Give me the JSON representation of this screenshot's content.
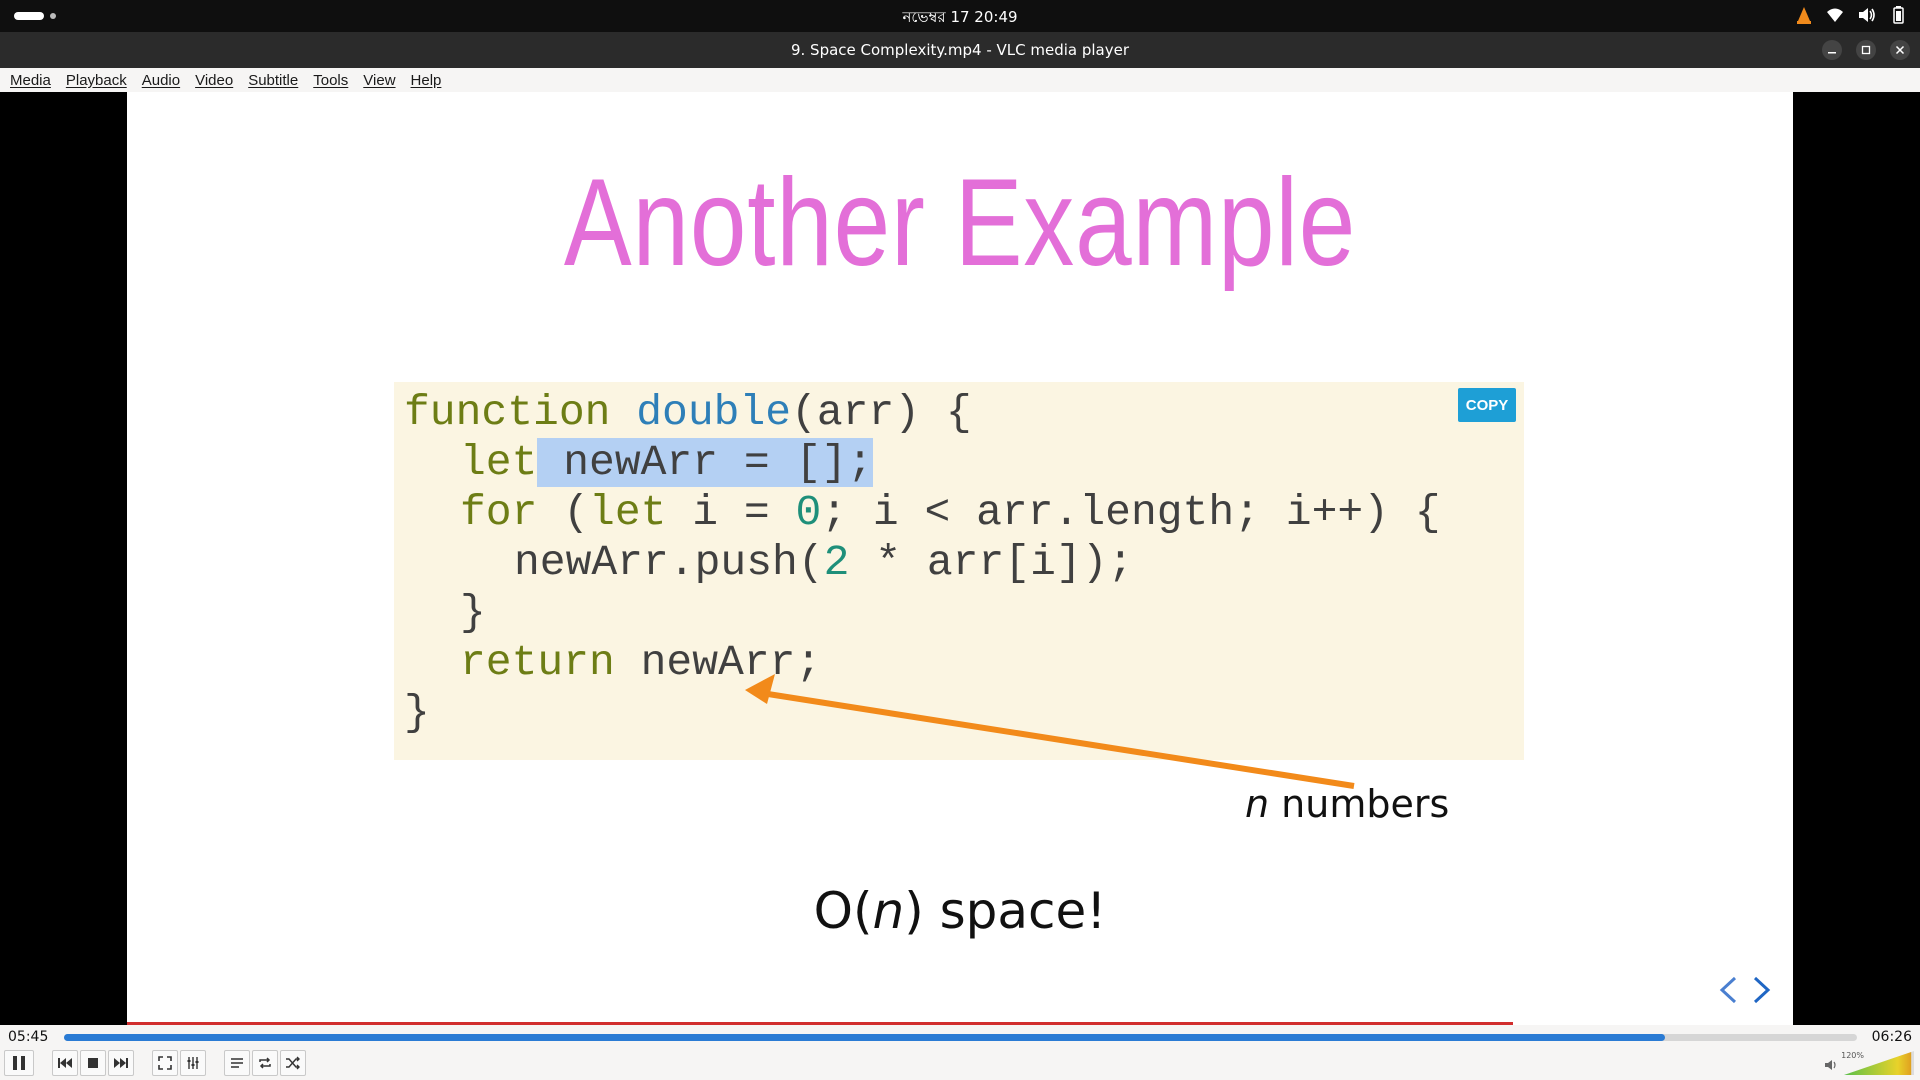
{
  "topbar": {
    "clock": "নভেম্বর 17  20:49"
  },
  "window": {
    "title": "9. Space Complexity.mp4 - VLC media player"
  },
  "menu": {
    "items": [
      "Media",
      "Playback",
      "Audio",
      "Video",
      "Subtitle",
      "Tools",
      "View",
      "Help"
    ]
  },
  "slide": {
    "title": "Another Example",
    "copy_label": "COPY",
    "code": {
      "l1_kw": "function",
      "l1_fn": "double",
      "l1_rest": "(arr) {",
      "l2_kw": "let",
      "l2_hl": " newArr = [];",
      "l3_kw1": "for",
      "l3_a": " (",
      "l3_kw2": "let",
      "l3_b": " i = ",
      "l3_num": "0",
      "l3_c": "; i < arr.length; i++) {",
      "l4_a": "newArr.push(",
      "l4_num": "2",
      "l4_b": " * arr[i]);",
      "l5": "}",
      "l6_kw": "return",
      "l6_rest": " newArr;",
      "l7": "}"
    },
    "annotation_var": "n",
    "annotation_text": " numbers",
    "big_pre": "O(",
    "big_var": "n",
    "big_post": ") space!"
  },
  "player": {
    "elapsed": "05:45",
    "total": "06:26",
    "progress": 0.893,
    "volume_label": "120%",
    "volume_level": 1.2,
    "accent_color": "#2a7bd4"
  }
}
